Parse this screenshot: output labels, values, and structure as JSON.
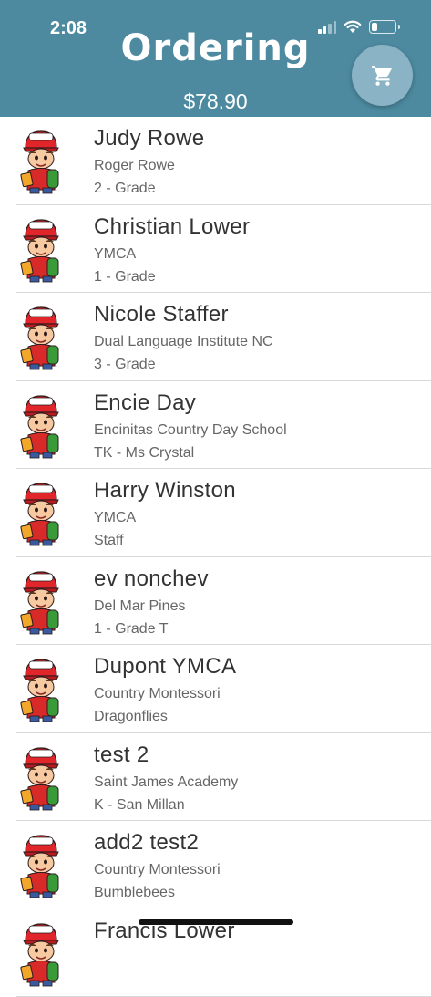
{
  "status_bar": {
    "time": "2:08",
    "battery_level": 0.25
  },
  "header": {
    "title": "Ordering",
    "total": "$78.90",
    "cart_icon": "cart-icon"
  },
  "students": [
    {
      "name": "Judy Rowe",
      "line1": "Roger Rowe",
      "line2": "2 - Grade"
    },
    {
      "name": "Christian Lower",
      "line1": "YMCA",
      "line2": "1 - Grade"
    },
    {
      "name": "Nicole Staffer",
      "line1": "Dual Language Institute NC",
      "line2": "3 - Grade"
    },
    {
      "name": "Encie Day",
      "line1": "Encinitas Country Day School",
      "line2": "TK - Ms Crystal"
    },
    {
      "name": "Harry Winston",
      "line1": "YMCA",
      "line2": "Staff"
    },
    {
      "name": "ev nonchev",
      "line1": "Del Mar Pines",
      "line2": "1 - Grade T"
    },
    {
      "name": "Dupont YMCA",
      "line1": "Country Montessori",
      "line2": "Dragonflies"
    },
    {
      "name": "test 2",
      "line1": "Saint James Academy",
      "line2": "K - San Millan"
    },
    {
      "name": "add2 test2",
      "line1": "Country Montessori",
      "line2": "Bumblebees"
    },
    {
      "name": "Francis Lower",
      "line1": "",
      "line2": ""
    }
  ]
}
